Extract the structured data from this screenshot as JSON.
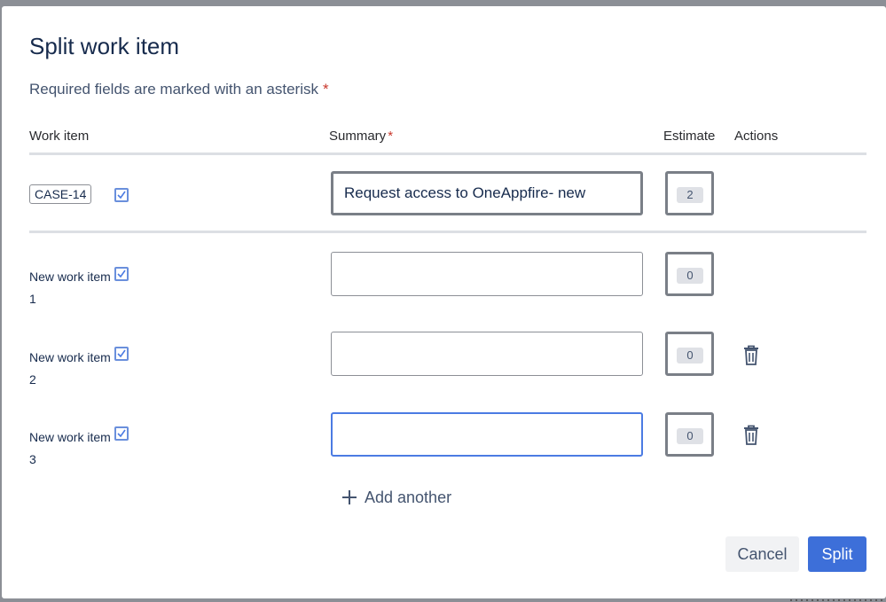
{
  "dialog": {
    "title": "Split work item",
    "required_note": "Required fields are marked with an asterisk",
    "asterisk": "*"
  },
  "columns": {
    "work_item": "Work item",
    "summary": "Summary",
    "estimate": "Estimate",
    "actions": "Actions"
  },
  "original": {
    "key": "CASE-14",
    "checked": true,
    "summary": "Request access to OneAppfire- new",
    "estimate": "2"
  },
  "new_items": [
    {
      "label": "New work item",
      "number": "1",
      "checked": true,
      "summary": "",
      "estimate": "0",
      "deletable": false
    },
    {
      "label": "New work item",
      "number": "2",
      "checked": true,
      "summary": "",
      "estimate": "0",
      "deletable": true
    },
    {
      "label": "New work item",
      "number": "3",
      "checked": true,
      "summary": "",
      "estimate": "0",
      "deletable": true
    }
  ],
  "add_another": {
    "label": "Add another",
    "icon": "plus-icon"
  },
  "footer": {
    "cancel_label": "Cancel",
    "split_label": "Split"
  },
  "colors": {
    "primary": "#3d6fd9",
    "required": "#c9372c",
    "focus": "#4b7be3"
  }
}
